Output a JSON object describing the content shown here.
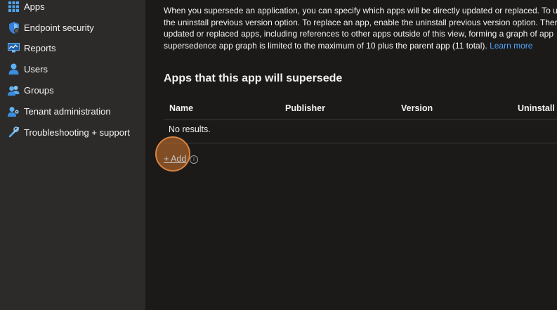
{
  "sidebar": {
    "items": [
      {
        "label": "Apps",
        "icon": "apps-grid-icon"
      },
      {
        "label": "Endpoint security",
        "icon": "shield-icon"
      },
      {
        "label": "Reports",
        "icon": "reports-monitor-icon"
      },
      {
        "label": "Users",
        "icon": "user-icon"
      },
      {
        "label": "Groups",
        "icon": "groups-icon"
      },
      {
        "label": "Tenant administration",
        "icon": "tenant-admin-icon"
      },
      {
        "label": "Troubleshooting + support",
        "icon": "wrench-icon"
      }
    ]
  },
  "main": {
    "description": {
      "line1": "When you supersede an application, you can specify which apps will be directly updated or replaced. To u",
      "line2": "the uninstall previous version option. To replace an app, enable the uninstall previous version option. Ther",
      "line3": "updated or replaced apps, including references to other apps outside of this view, forming a graph of app",
      "line4": "supersedence app graph is limited to the maximum of 10 plus the parent app (11 total).",
      "learn_more": "Learn more"
    },
    "section_title": "Apps that this app will supersede",
    "table": {
      "columns": [
        "Name",
        "Publisher",
        "Version",
        "Uninstall p"
      ],
      "empty_text": "No results."
    },
    "add_label": "+ Add",
    "info_glyph": "i"
  },
  "colors": {
    "sidebar_bg": "#2c2b2a",
    "main_bg": "#1b1a19",
    "link": "#4fa3f7",
    "click_highlight": "#d9823f"
  }
}
